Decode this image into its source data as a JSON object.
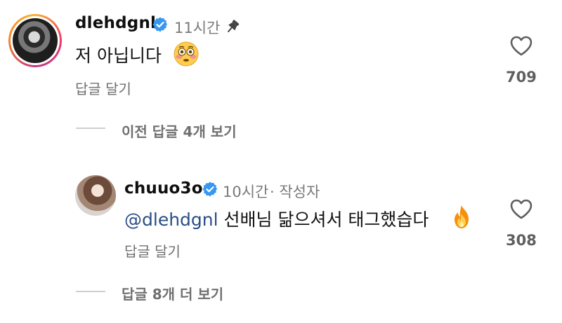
{
  "comment1": {
    "username": "dlehdgnl",
    "time": "11시간",
    "text": "저 아닙니다",
    "reply_label": "답글 달기",
    "likes": "709",
    "emoji": "flushed-face"
  },
  "view_previous": {
    "label": "이전 답글 4개 보기"
  },
  "comment2": {
    "username": "chuuo3o",
    "time": "10시간",
    "author_tag": "· 작성자",
    "mention": "@dlehdgnl",
    "text": "선배님 닮으셔서 태그했습다",
    "reply_label": "답글 달기",
    "likes": "308",
    "emoji": "fire"
  },
  "view_more": {
    "label": "답글 8개 더 보기"
  },
  "colors": {
    "verified": "#3897f0",
    "mention": "#2a4e86",
    "divider": "#cfcfcf"
  }
}
